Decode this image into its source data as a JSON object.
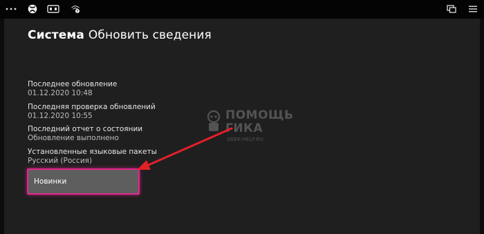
{
  "topbar": {
    "icons": [
      "more-icon",
      "xbox-icon",
      "media-icon",
      "network-icon",
      "snap-window-icon",
      "menu-icon"
    ]
  },
  "header": {
    "section": "Система",
    "page": "Обновить сведения"
  },
  "info": {
    "items": [
      {
        "label": "Последнее обновление",
        "value": "01.12.2020 10:48"
      },
      {
        "label": "Последняя проверка обновлений",
        "value": "01.12.2020 10:55"
      },
      {
        "label": "Последний отчет о состоянии",
        "value": "Обновление выполнено"
      },
      {
        "label": "Установленные языковые пакеты",
        "value": "Русский (Россия)"
      }
    ]
  },
  "actions": {
    "whats_new_label": "Новинки"
  },
  "watermark": {
    "line1": "ПОМОЩЬ",
    "line2": "ГИКА",
    "url": "GEEK-HELP.RU"
  },
  "colors": {
    "accent_focus": "#e6258f",
    "annotation_arrow": "#e3202a",
    "background": "#1f1f1f"
  }
}
